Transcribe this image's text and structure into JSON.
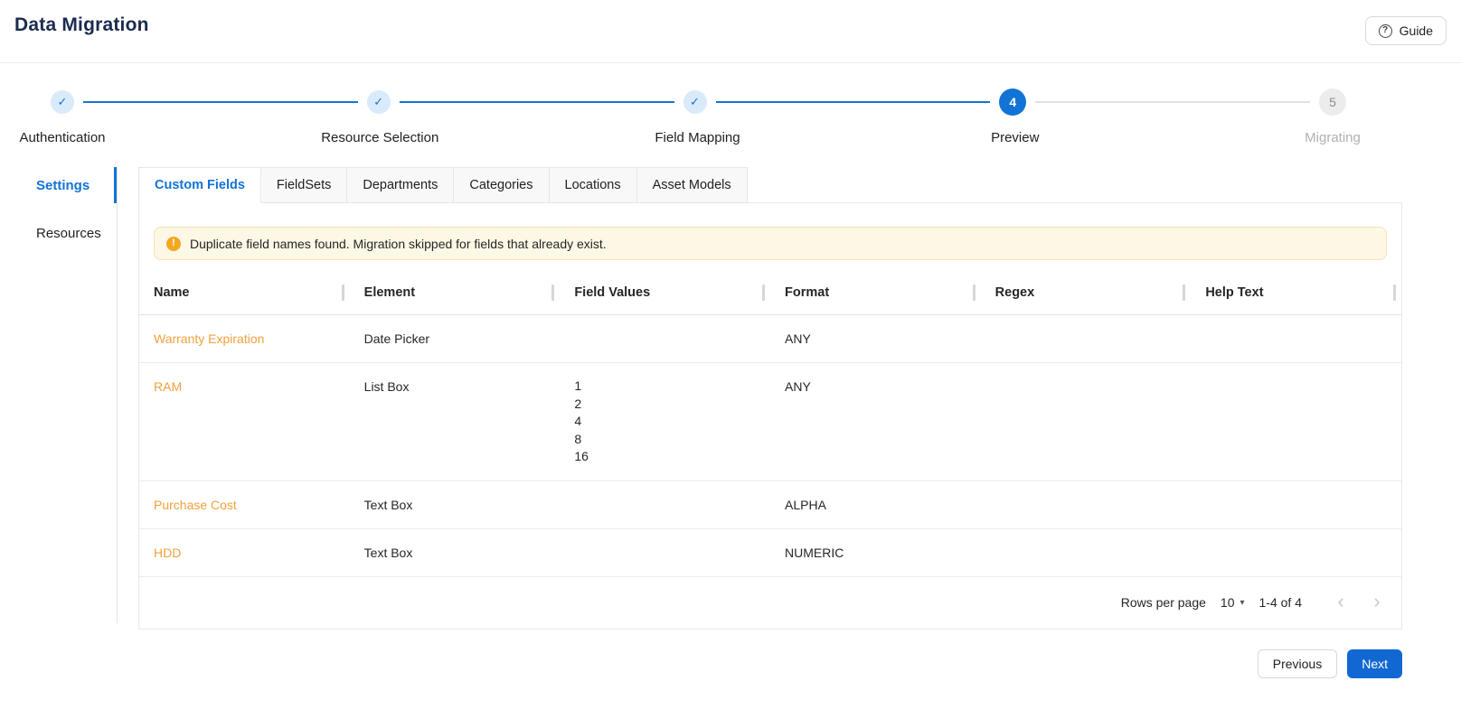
{
  "header": {
    "title": "Data Migration",
    "guide_label": "Guide"
  },
  "icons": {
    "question": "?",
    "check": "✓",
    "warning": "!",
    "caret_down": "▾",
    "chevron_left": "‹",
    "chevron_right": "›"
  },
  "stepper": {
    "steps": [
      {
        "label": "Authentication",
        "state": "done"
      },
      {
        "label": "Resource Selection",
        "state": "done"
      },
      {
        "label": "Field Mapping",
        "state": "done"
      },
      {
        "label": "Preview",
        "state": "active",
        "number": "4"
      },
      {
        "label": "Migrating",
        "state": "pending",
        "number": "5"
      }
    ]
  },
  "sidebar": {
    "items": [
      {
        "label": "Settings",
        "active": true
      },
      {
        "label": "Resources",
        "active": false
      }
    ]
  },
  "tabs": [
    {
      "label": "Custom Fields",
      "active": true
    },
    {
      "label": "FieldSets",
      "active": false
    },
    {
      "label": "Departments",
      "active": false
    },
    {
      "label": "Categories",
      "active": false
    },
    {
      "label": "Locations",
      "active": false
    },
    {
      "label": "Asset Models",
      "active": false
    }
  ],
  "warning": {
    "text": "Duplicate field names found. Migration skipped for fields that already exist."
  },
  "table": {
    "columns": [
      "Name",
      "Element",
      "Field Values",
      "Format",
      "Regex",
      "Help Text"
    ],
    "rows": [
      {
        "name": "Warranty Expiration",
        "element": "Date Picker",
        "field_values": [],
        "format": "ANY",
        "regex": "",
        "help_text": ""
      },
      {
        "name": "RAM",
        "element": "List Box",
        "field_values": [
          "1",
          "2",
          "4",
          "8",
          "16"
        ],
        "format": "ANY",
        "regex": "",
        "help_text": ""
      },
      {
        "name": "Purchase Cost",
        "element": "Text Box",
        "field_values": [],
        "format": "ALPHA",
        "regex": "",
        "help_text": ""
      },
      {
        "name": "HDD",
        "element": "Text Box",
        "field_values": [],
        "format": "NUMERIC",
        "regex": "",
        "help_text": ""
      }
    ]
  },
  "pagination": {
    "rows_per_page_label": "Rows per page",
    "rows_per_page_value": "10",
    "range_label": "1-4 of 4"
  },
  "footer": {
    "previous_label": "Previous",
    "next_label": "Next"
  },
  "colors": {
    "accent_blue": "#1273d6",
    "link_orange": "#f0a13c",
    "warning_bg": "#fdf7e6",
    "warning_icon": "#f5a623",
    "title_navy": "#1b2b4f"
  }
}
